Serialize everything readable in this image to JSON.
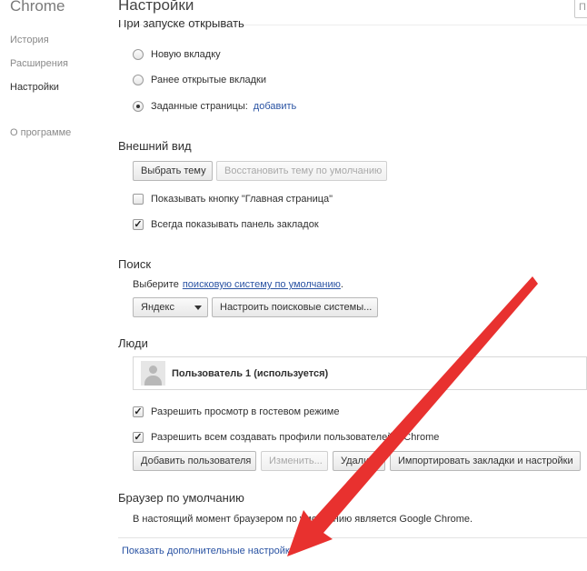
{
  "sidebar": {
    "brand": "Chrome",
    "items": [
      {
        "label": "История"
      },
      {
        "label": "Расширения"
      },
      {
        "label": "Настройки"
      },
      {
        "label": "О программе"
      }
    ]
  },
  "header": {
    "title": "Настройки",
    "search_placeholder": "П"
  },
  "startup": {
    "title": "При запуске открывать",
    "options": [
      {
        "label": "Новую вкладку",
        "checked": false
      },
      {
        "label": "Ранее открытые вкладки",
        "checked": false
      },
      {
        "label": "Заданные страницы:",
        "checked": true
      }
    ],
    "add_link": "добавить"
  },
  "appearance": {
    "title": "Внешний вид",
    "choose_theme": "Выбрать тему",
    "reset_theme": "Восстановить тему по умолчанию",
    "show_home": "Показывать кнопку \"Главная страница\"",
    "show_bookmarks": "Всегда показывать панель закладок"
  },
  "search": {
    "title": "Поиск",
    "prefix": "Выберите",
    "link": "поисковую систему по умолчанию",
    "suffix": ".",
    "engine": "Яндекс",
    "manage": "Настроить поисковые системы..."
  },
  "people": {
    "title": "Люди",
    "profile": "Пользователь 1 (используется)",
    "guest": "Разрешить просмотр в гостевом режиме",
    "anyone": "Разрешить всем создавать профили пользователей в Chrome",
    "add_user": "Добавить пользователя",
    "edit": "Изменить...",
    "delete": "Удалить",
    "import": "Импортировать закладки и настройки"
  },
  "default_browser": {
    "title": "Браузер по умолчанию",
    "status": "В настоящий момент браузером по умолчанию является Google Chrome."
  },
  "footer": {
    "advanced": "Показать дополнительные настройки"
  },
  "colors": {
    "link": "#2a53a3",
    "arrow": "#e8312f"
  }
}
